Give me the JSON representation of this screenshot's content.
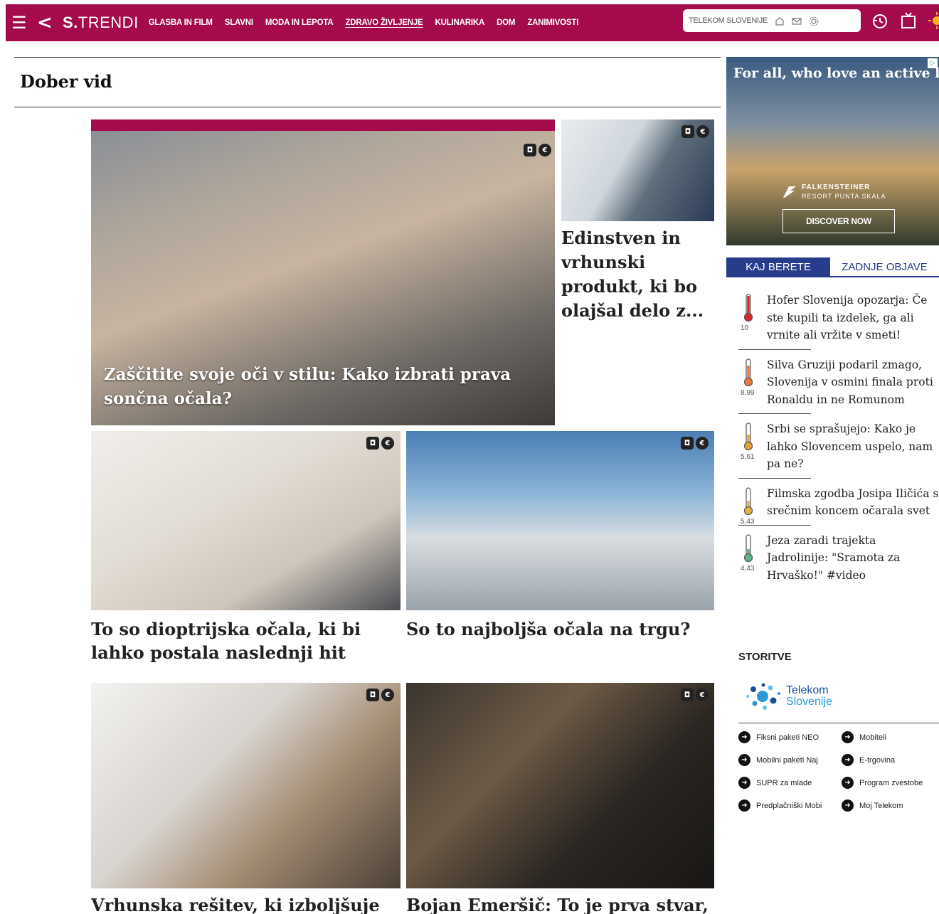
{
  "topbar": {
    "logo_bold": "S.",
    "logo_light": "TRENDI",
    "nav": [
      {
        "label": "GLASBA IN FILM"
      },
      {
        "label": "SLAVNI"
      },
      {
        "label": "MODA IN LEPOTA"
      },
      {
        "label": "ZDRAVO ŽIVLJENJE"
      },
      {
        "label": "KULINARIKA"
      },
      {
        "label": "DOM"
      },
      {
        "label": "ZANIMIVOSTI"
      }
    ],
    "active_nav": "ZDRAVO ŽIVLJENJE",
    "telekom_label": "TELEKOM SLOVENIJE",
    "brand_color": "#a40a4c"
  },
  "section": {
    "title": "Dober vid"
  },
  "articles": {
    "lead": {
      "headline": "Zaščitite svoje oči v stilu: Kako izbrati prava sončna očala?"
    },
    "side": {
      "headline": "Edinstven in vrhunski produkt, ki bo olajšal delo z..."
    },
    "mid_left": {
      "headline": "To so dioptrijska očala, ki bi lahko postala naslednji hit"
    },
    "mid_right": {
      "headline": "So to najboljša očala na trgu?"
    },
    "bottom_left": {
      "headline": "Vrhunska rešitev, ki izboljšuje"
    },
    "bottom_right": {
      "headline": "Bojan Emeršič: To je prva stvar, ki"
    }
  },
  "ad": {
    "headline": "For all, who love an active life",
    "brand": "FALKENSTEINER",
    "brand_sub": "RESORT PUNTA SKALA",
    "cta": "DISCOVER NOW"
  },
  "tabs": {
    "active": "KAJ BERETE",
    "inactive": "ZADNJE OBJAVE"
  },
  "most_read": [
    {
      "text": "Hofer Slovenija opozarja: Če ste kupili ta izdelek, ga ali vrnite ali vržite v smeti!",
      "score": "10",
      "level": 1.0
    },
    {
      "text": "Silva Gruziji podaril zmago, Slovenija v osmini finala proti Ronaldu in ne Romunom",
      "score": "8,99",
      "level": 0.8
    },
    {
      "text": "Srbi se sprašujejo: Kako je lahko Slovencem uspelo, nam pa ne?",
      "score": "5,61",
      "level": 0.5
    },
    {
      "text": "Filmska zgodba Josipa Iličića s srečnim koncem očarala svet",
      "score": "5,43",
      "level": 0.45
    },
    {
      "text": "Jeza zaradi trajekta Jadrolinije: \"Sramota za Hrvaško!\" #video",
      "score": "4,43",
      "level": 0.35
    }
  ],
  "services": {
    "title": "STORITVE",
    "logo_line1": "Telekom",
    "logo_line2": "Slovenije",
    "items": [
      {
        "label": "Fiksni paketi NEO"
      },
      {
        "label": "Mobiteli"
      },
      {
        "label": "Mobilni paketi Naj"
      },
      {
        "label": "E-trgovina"
      },
      {
        "label": "SUPR za mlade"
      },
      {
        "label": "Program zvestobe"
      },
      {
        "label": "Predplačniški Mobi"
      },
      {
        "label": "Moj Telekom"
      }
    ]
  }
}
